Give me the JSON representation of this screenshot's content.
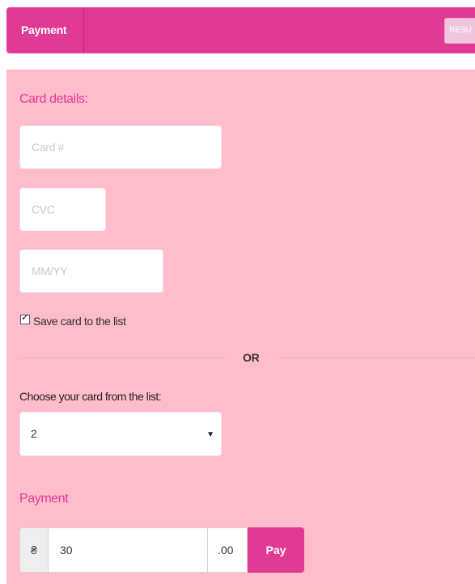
{
  "header": {
    "title": "Payment",
    "right_button_label": "RESU"
  },
  "card_section": {
    "title": "Card details:",
    "card_number": {
      "placeholder": "Card #",
      "value": ""
    },
    "cvc": {
      "placeholder": "CVC",
      "value": ""
    },
    "expiry": {
      "placeholder": "MM/YY",
      "value": ""
    },
    "save_card": {
      "label": "Save card to the list",
      "checked": true
    }
  },
  "separator": {
    "label": "OR"
  },
  "saved_cards": {
    "label": "Choose your card from the list:",
    "selected": "2"
  },
  "payment_section": {
    "title": "Payment",
    "currency_symbol": "₴",
    "amount": "30",
    "decimals": ".00",
    "pay_label": "Pay"
  },
  "colors": {
    "accent": "#e13a95",
    "panel_background": "#ffbccb"
  }
}
